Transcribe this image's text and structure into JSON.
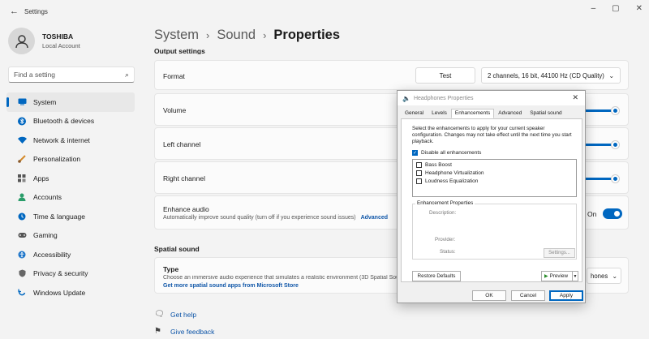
{
  "window": {
    "title": "Settings"
  },
  "profile": {
    "name": "TOSHIBA",
    "account": "Local Account"
  },
  "search": {
    "placeholder": "Find a setting"
  },
  "nav": [
    {
      "label": "System",
      "icon": "monitor-icon",
      "color": "#0067c0",
      "active": true
    },
    {
      "label": "Bluetooth & devices",
      "icon": "bluetooth-icon",
      "color": "#0067c0"
    },
    {
      "label": "Network & internet",
      "icon": "wifi-icon",
      "color": "#0067c0"
    },
    {
      "label": "Personalization",
      "icon": "brush-icon",
      "color": "#d48a2a"
    },
    {
      "label": "Apps",
      "icon": "apps-icon",
      "color": "#555555"
    },
    {
      "label": "Accounts",
      "icon": "person-icon",
      "color": "#2a9d6a"
    },
    {
      "label": "Time & language",
      "icon": "globe-clock-icon",
      "color": "#0067c0"
    },
    {
      "label": "Gaming",
      "icon": "gamepad-icon",
      "color": "#555555"
    },
    {
      "label": "Accessibility",
      "icon": "accessibility-icon",
      "color": "#1a73c8"
    },
    {
      "label": "Privacy & security",
      "icon": "shield-icon",
      "color": "#555555"
    },
    {
      "label": "Windows Update",
      "icon": "update-icon",
      "color": "#0067c0"
    }
  ],
  "breadcrumb": {
    "part1": "System",
    "part2": "Sound",
    "current": "Properties"
  },
  "output_settings": {
    "section": "Output settings",
    "format_label": "Format",
    "test_label": "Test",
    "format_value": "2 channels, 16 bit, 44100 Hz (CD Quality)",
    "volume_label": "Volume",
    "left_label": "Left channel",
    "right_label": "Right channel",
    "enhance_title": "Enhance audio",
    "enhance_desc": "Automatically improve sound quality (turn off if you experience sound issues)",
    "enhance_link": "Advanced",
    "toggle_state": "On"
  },
  "spatial": {
    "section": "Spatial sound",
    "type_label": "Type",
    "type_desc": "Choose an immersive audio experience that simulates a realistic environment (3D Spatial Sou",
    "type_link": "Get more spatial sound apps from Microsoft Store",
    "type_value": "hones"
  },
  "help": {
    "get_help": "Get help",
    "feedback": "Give feedback"
  },
  "dialog": {
    "title": "Headphones Properties",
    "tabs": [
      "General",
      "Levels",
      "Enhancements",
      "Advanced",
      "Spatial sound"
    ],
    "active_tab": "Enhancements",
    "intro": "Select the enhancements to apply for your current speaker configuration. Changes may not take effect until the next time you start playback.",
    "disable_all": "Disable all enhancements",
    "enhancements": [
      "Bass Boost",
      "Headphone Virtualization",
      "Loudness Equalization"
    ],
    "props_title": "Enhancement Properties",
    "description_label": "Description:",
    "provider_label": "Provider:",
    "status_label": "Status:",
    "settings_btn": "Settings...",
    "restore_btn": "Restore Defaults",
    "preview_btn": "Preview",
    "ok": "OK",
    "cancel": "Cancel",
    "apply": "Apply"
  }
}
